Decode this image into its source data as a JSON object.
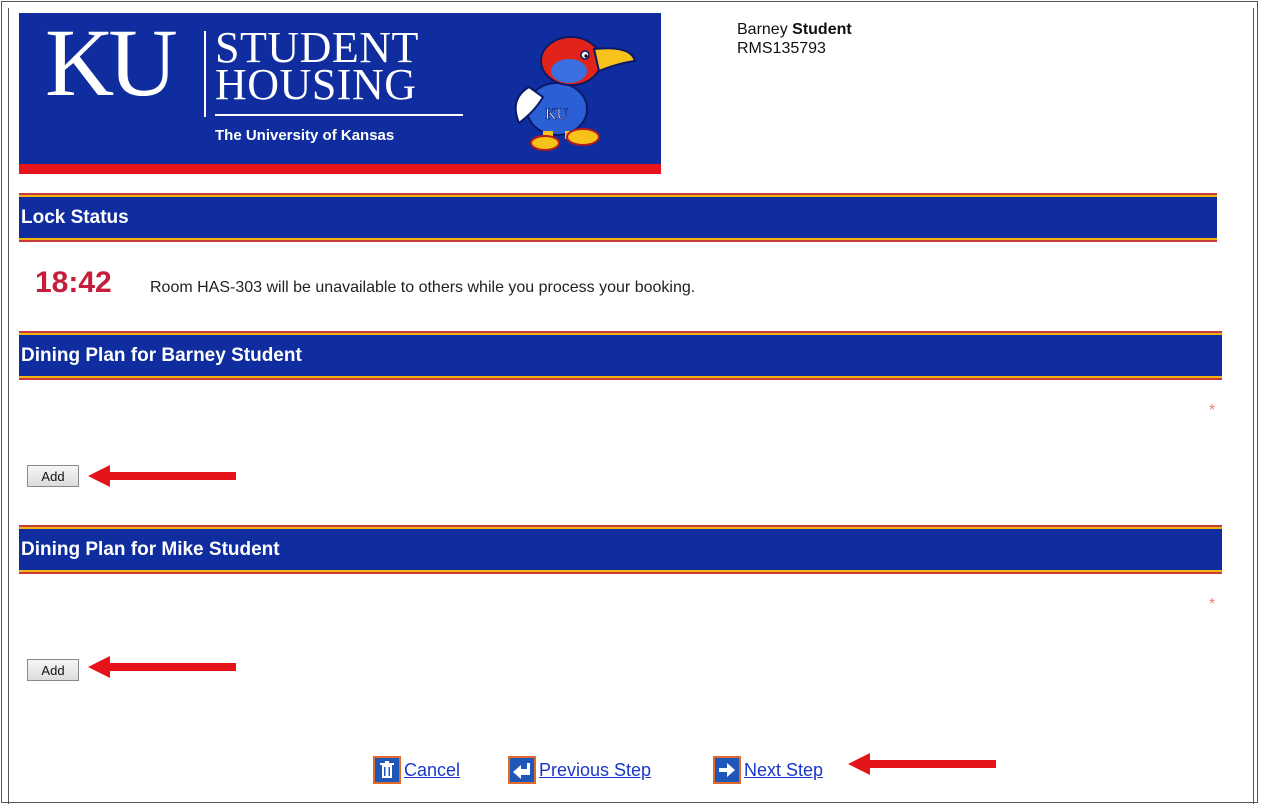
{
  "banner": {
    "letters": "KU",
    "line1": "STUDENT",
    "line2": "HOUSING",
    "university": "The University of Kansas",
    "mascot_letters": "KU",
    "colors": {
      "blue": "#0f2d9e",
      "red": "#e8141b"
    }
  },
  "user": {
    "first_name": "Barney",
    "last_name": "Student",
    "id": "RMS135793"
  },
  "lock": {
    "heading": "Lock Status",
    "timer": "18:42",
    "message": "Room HAS-303 will be unavailable to others while you process your booking."
  },
  "sections": [
    {
      "heading": "Dining Plan for Barney Student",
      "required_mark": "*",
      "add_label": "Add"
    },
    {
      "heading": "Dining Plan for Mike Student",
      "required_mark": "*",
      "add_label": "Add"
    }
  ],
  "nav": {
    "cancel": {
      "label": "Cancel",
      "icon": "trash-icon"
    },
    "previous": {
      "label": "Previous Step",
      "icon": "arrow-left-icon"
    },
    "next": {
      "label": "Next Step",
      "icon": "arrow-right-icon"
    }
  },
  "annotation_color": "#e5141b"
}
